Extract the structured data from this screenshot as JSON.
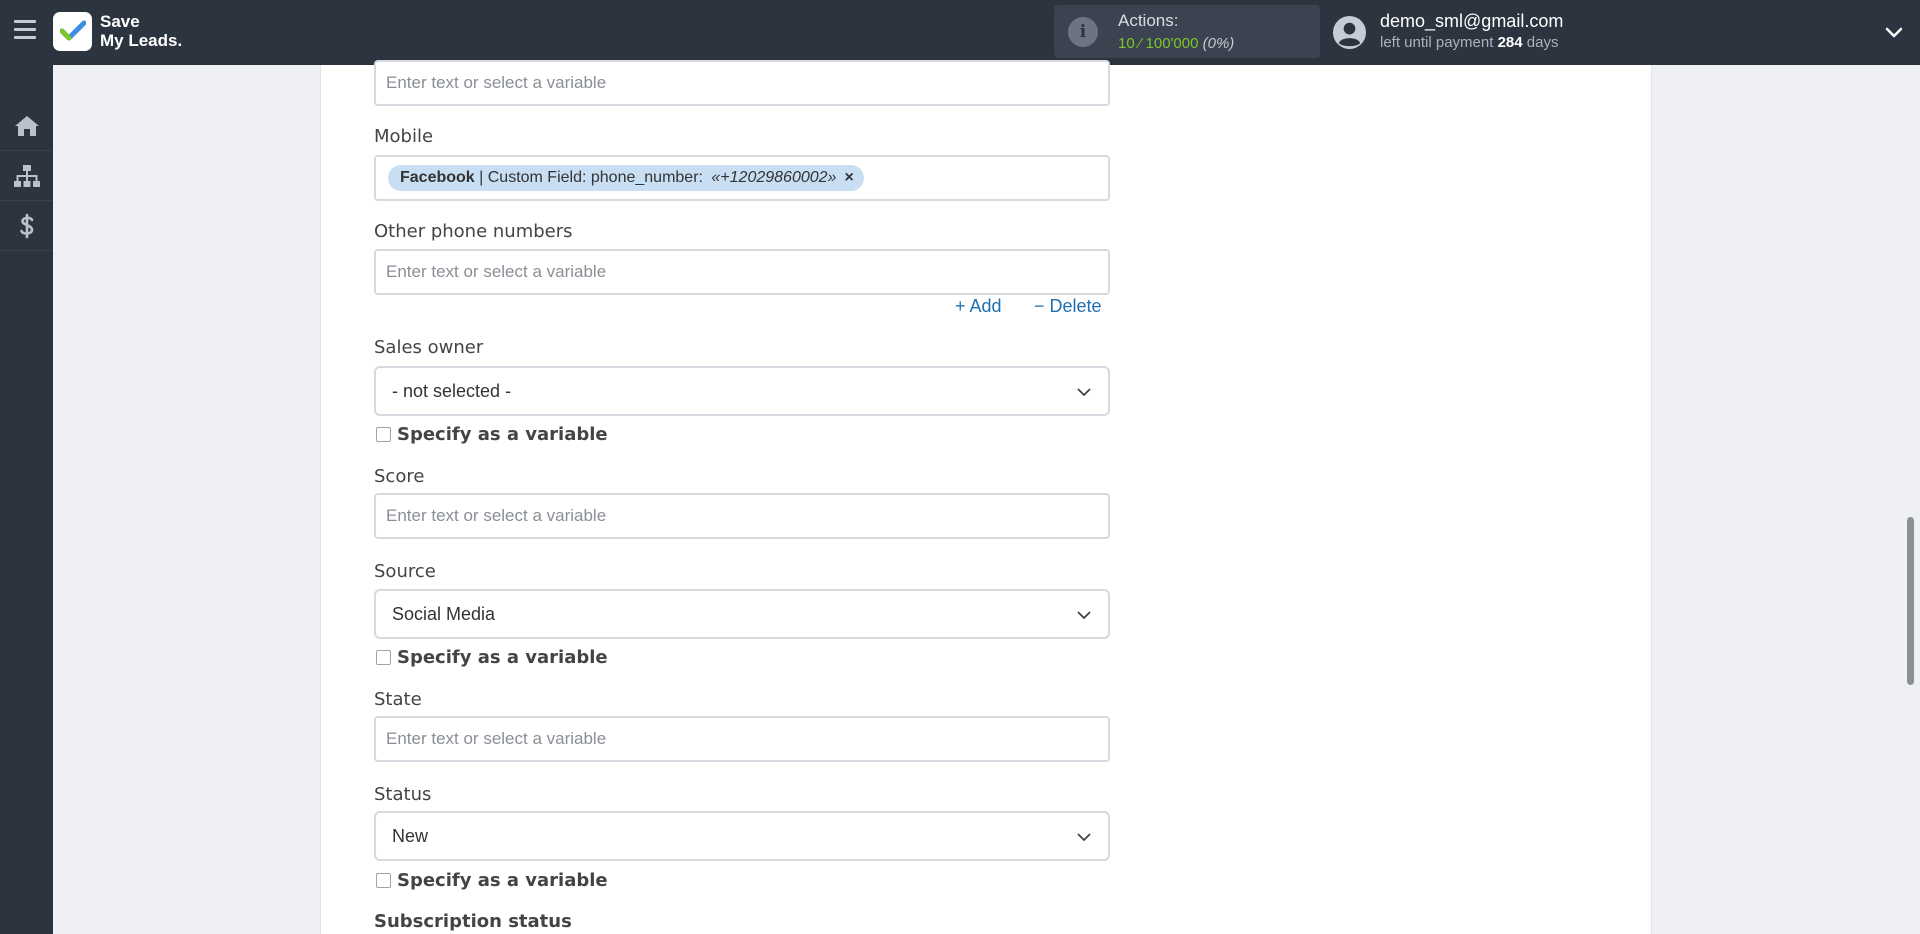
{
  "app": {
    "logo_line1": "Save",
    "logo_line2": "My Leads."
  },
  "header": {
    "actions_label": "Actions:",
    "actions_used": "10",
    "actions_sep": " ⁄ ",
    "actions_total": "100'000",
    "actions_pct": "(0%)",
    "user_email": "demo_sml@gmail.com",
    "payment_prefix": "left until payment ",
    "payment_days": "284",
    "payment_suffix": " days"
  },
  "sidebar": {
    "items": [
      {
        "icon": "home-icon"
      },
      {
        "icon": "sitemap-icon"
      },
      {
        "icon": "dollar-icon"
      }
    ]
  },
  "form": {
    "top_field": {
      "placeholder": "Enter text or select a variable"
    },
    "mobile": {
      "label": "Mobile",
      "tag_source": "Facebook",
      "tag_field": " | Custom Field: phone_number: ",
      "tag_value": "«+12029860002»",
      "tag_remove": "×"
    },
    "other_phone": {
      "label": "Other phone numbers",
      "placeholder": "Enter text or select a variable",
      "add_label": "+ Add",
      "delete_label": "− Delete"
    },
    "sales_owner": {
      "label": "Sales owner",
      "value": "- not selected -",
      "checkbox_label": "Specify as a variable"
    },
    "score": {
      "label": "Score",
      "placeholder": "Enter text or select a variable"
    },
    "source": {
      "label": "Source",
      "value": "Social Media",
      "checkbox_label": "Specify as a variable"
    },
    "state": {
      "label": "State",
      "placeholder": "Enter text or select a variable"
    },
    "status": {
      "label": "Status",
      "value": "New",
      "checkbox_label": "Specify as a variable"
    },
    "subscription_status": {
      "label": "Subscription status"
    }
  },
  "colors": {
    "topbar": "#2c3440",
    "accent_green": "#7cc52e",
    "link_blue": "#1f6fb0",
    "tag_bg": "#c8def3"
  }
}
